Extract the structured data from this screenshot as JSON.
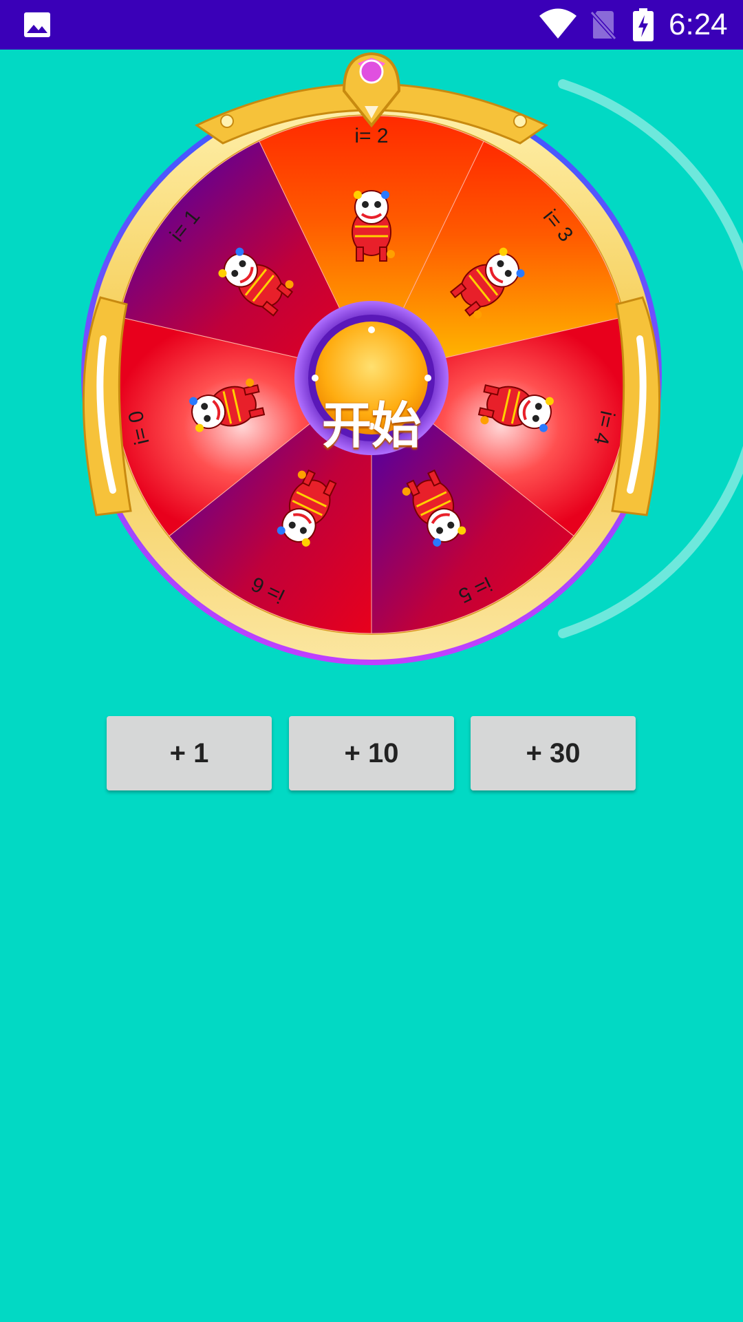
{
  "status_bar": {
    "time": "6:24",
    "icons": [
      "gallery-icon",
      "wifi-icon",
      "no-sim-icon",
      "battery-charging-icon"
    ],
    "background": "#3a00b8"
  },
  "wheel": {
    "center_label": "开始",
    "segments": [
      {
        "label": "i= 0"
      },
      {
        "label": "i= 1"
      },
      {
        "label": "i= 2"
      },
      {
        "label": "i= 3"
      },
      {
        "label": "i= 4"
      },
      {
        "label": "i= 5"
      },
      {
        "label": "i= 6"
      }
    ],
    "segment_icon": "lion-dance-icon",
    "rim_color": "#f4c84a",
    "segment_colors": [
      "#e8001c",
      "#ff8a00",
      "#3a00b8"
    ]
  },
  "buttons": [
    {
      "label": "+ 1"
    },
    {
      "label": "+ 10"
    },
    {
      "label": "+ 30"
    }
  ],
  "colors": {
    "background": "#02d9c4",
    "button_bg": "#d6d7d7"
  }
}
